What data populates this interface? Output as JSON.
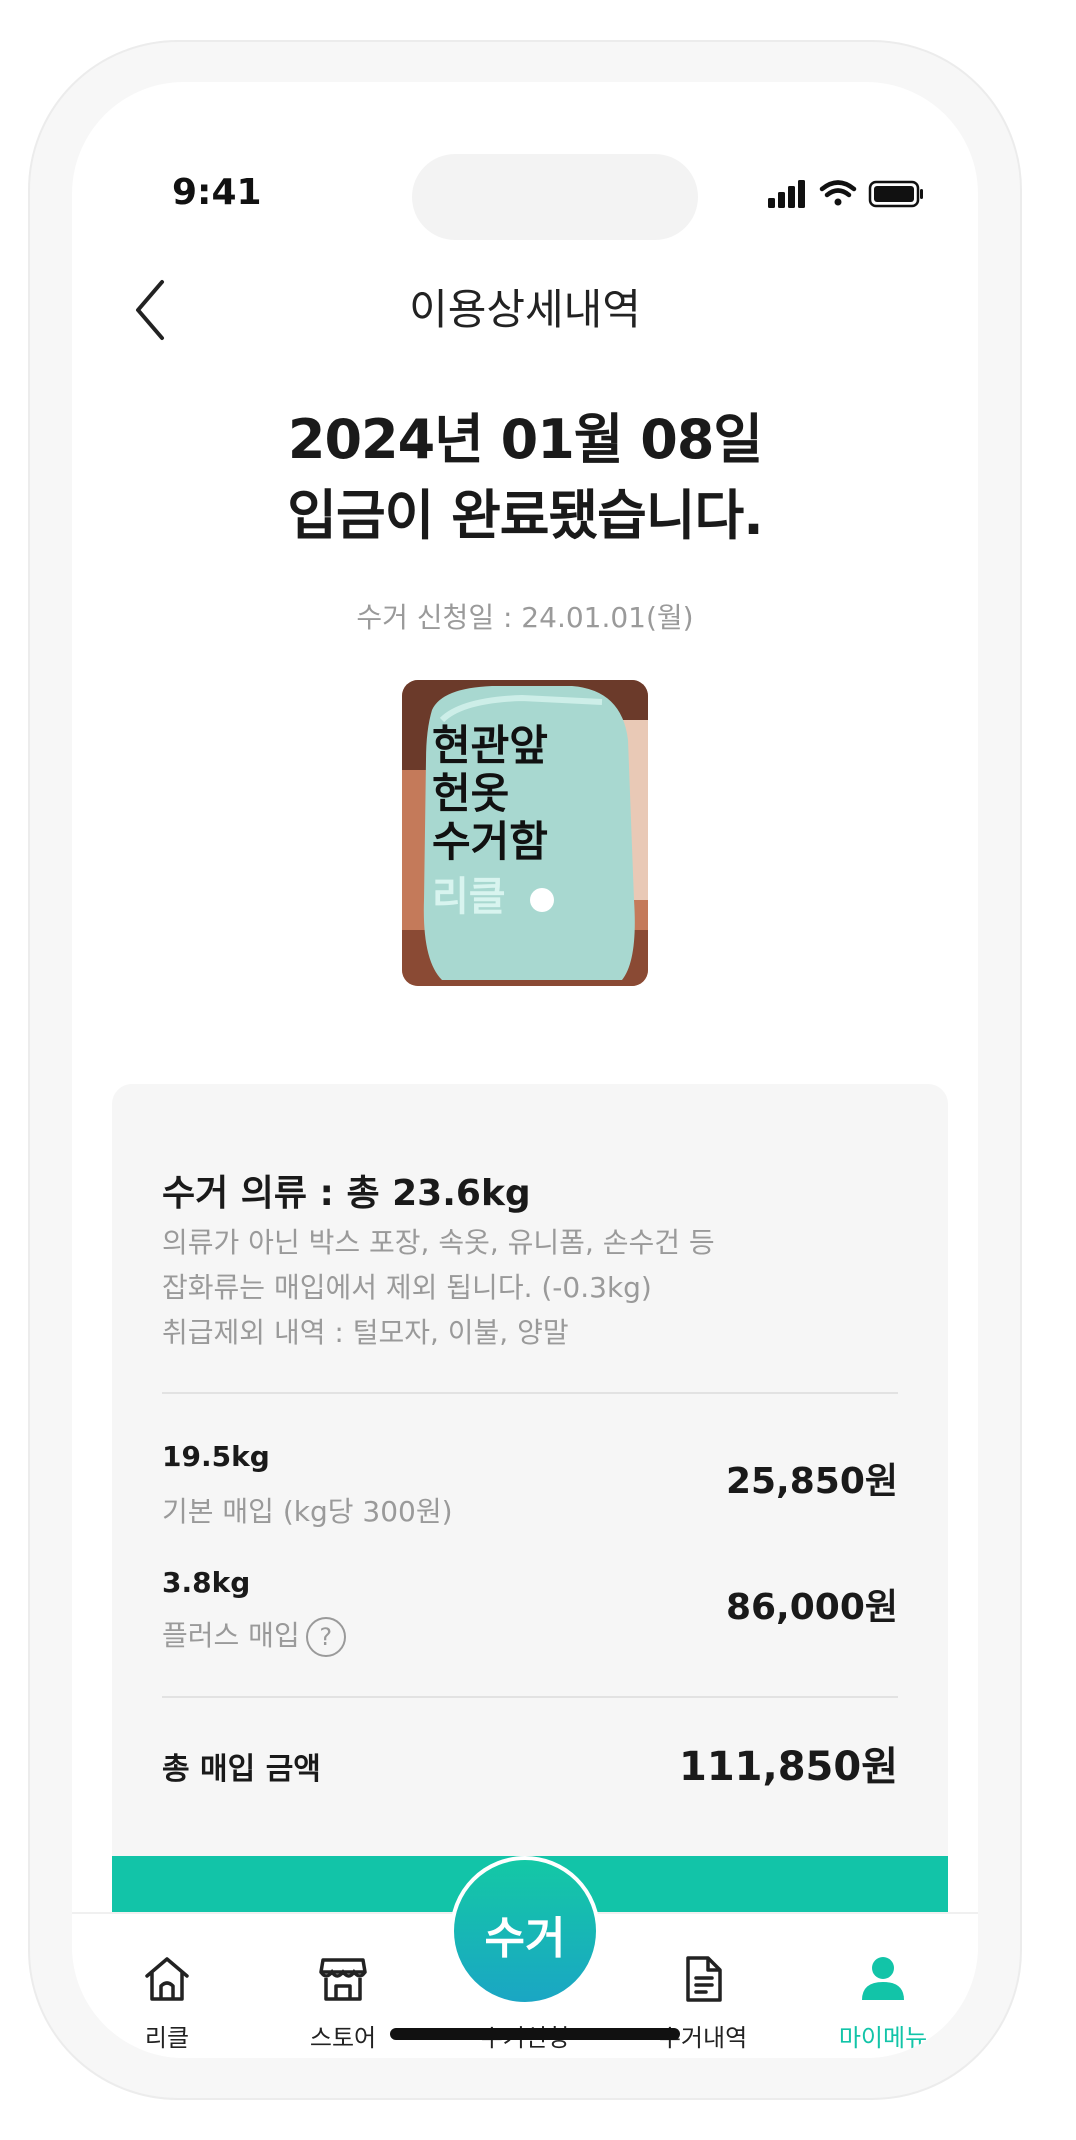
{
  "status_bar": {
    "time": "9:41"
  },
  "header": {
    "title": "이용상세내역"
  },
  "headline": {
    "line1": "2024년 01월 08일",
    "line2": "입금이 완료됐습니다."
  },
  "apply_date": "수거 신청일 : 24.01.01(월)",
  "photo": {
    "bag_text_lines": [
      "현관앞",
      "헌옷",
      "수거함",
      "리클"
    ]
  },
  "summary": {
    "title": "수거 의류 : 총 23.6kg",
    "note_lines": [
      "의류가 아닌 박스 포장, 속옷, 유니폼, 손수건 등",
      "잡화류는 매입에서 제외 됩니다. (-0.3kg)",
      "취급제외 내역 : 털모자, 이불, 양말"
    ],
    "rows": [
      {
        "weight": "19.5kg",
        "desc": "기본 매입 (kg당 300원)",
        "amount": "25,850원"
      },
      {
        "weight": "3.8kg",
        "desc": "플러스 매입",
        "amount": "86,000원"
      }
    ],
    "help_icon_glyph": "?",
    "total_label": "총 매입 금액",
    "total_amount": "111,850원"
  },
  "tabbar": {
    "fab_label": "수거",
    "items": [
      {
        "label": "리클",
        "icon": "home-icon"
      },
      {
        "label": "스토어",
        "icon": "store-icon"
      },
      {
        "label": "수거신청",
        "icon": "pickup-fab"
      },
      {
        "label": "수거내역",
        "icon": "document-icon"
      },
      {
        "label": "마이메뉴",
        "icon": "person-icon",
        "active": true
      }
    ]
  },
  "colors": {
    "accent": "#12c4a8",
    "card_bg": "#f6f6f6",
    "muted_text": "#9a9a9a"
  }
}
